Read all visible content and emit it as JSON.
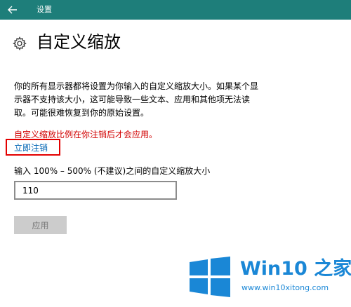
{
  "window": {
    "title": "设置",
    "back_icon": "back-arrow-icon",
    "titlebar_color": "#1e7e7a"
  },
  "page": {
    "icon": "gear-icon",
    "title": "自定义缩放"
  },
  "description": {
    "line1": "你的所有显示器都将设置为你输入的自定义缩放大小。如果某个显",
    "line2": "示器不支持该大小，这可能导致一些文本、应用和其他项无法读",
    "line3": "取。可能很难恢复到你的原始设置。"
  },
  "warning": {
    "text": "自定义缩放比例在你注销后才会应用。",
    "color": "#d10000"
  },
  "signout_link": {
    "label": "立即注销",
    "color": "#0064b4"
  },
  "scale_input": {
    "label": "输入 100% – 500% (不建议)之间的自定义缩放大小",
    "value": "110"
  },
  "apply_button": {
    "label": "应用",
    "enabled": false
  },
  "watermark": {
    "brand": "Win10 之家",
    "url": "www.win10xitong.com",
    "color": "#1a87d6"
  }
}
